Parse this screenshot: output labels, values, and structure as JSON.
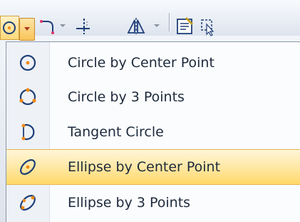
{
  "toolbar": {
    "items": [
      {
        "icon": "circle-center-icon"
      },
      {
        "icon": "dropdown-arrow-icon"
      },
      {
        "icon": "arc-icon"
      },
      {
        "icon": "line-tool-icon"
      },
      {
        "icon": "mirror-icon"
      },
      {
        "icon": "sketch-properties-icon"
      },
      {
        "icon": "select-icon"
      }
    ]
  },
  "menu": {
    "items": [
      {
        "label": "Circle by Center Point",
        "icon": "circle-center-point-icon",
        "highlighted": false
      },
      {
        "label": "Circle by 3 Points",
        "icon": "circle-3-points-icon",
        "highlighted": false
      },
      {
        "label": "Tangent Circle",
        "icon": "tangent-circle-icon",
        "highlighted": false
      },
      {
        "label": "Ellipse by Center Point",
        "icon": "ellipse-center-point-icon",
        "highlighted": true
      },
      {
        "label": "Ellipse by 3 Points",
        "icon": "ellipse-3-points-icon",
        "highlighted": false
      }
    ]
  },
  "colors": {
    "icon_stroke": "#1f3f78",
    "point_orange": "#f08a10",
    "highlight": "#ffd968"
  }
}
